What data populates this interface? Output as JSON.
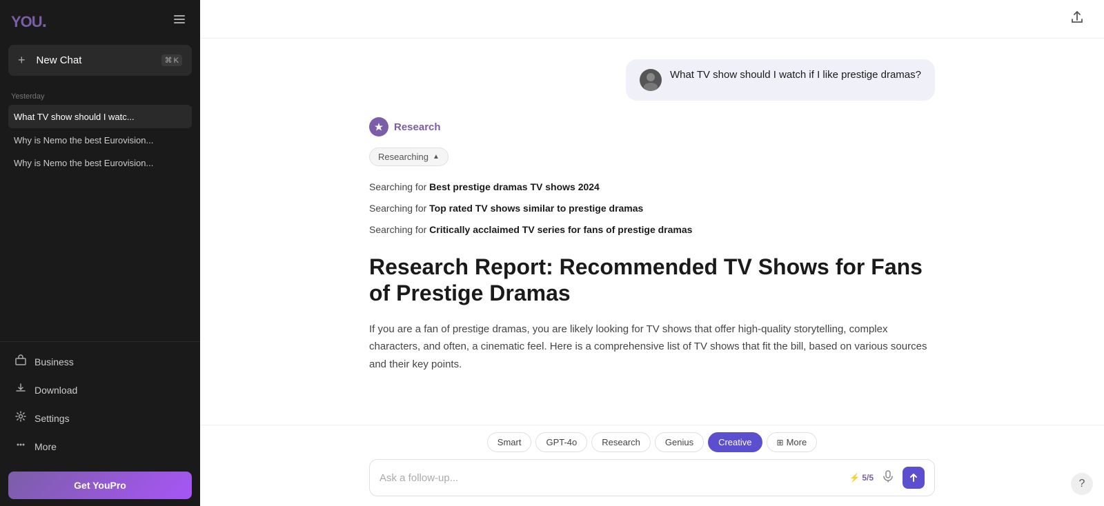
{
  "sidebar": {
    "logo_text": "YOU",
    "logo_dot": ".",
    "new_chat_label": "New Chat",
    "new_chat_shortcut_cmd": "⌘",
    "new_chat_shortcut_key": "K",
    "history_section_label": "Yesterday",
    "history_items": [
      {
        "id": "h1",
        "text": "What TV show should I watc...",
        "active": true
      },
      {
        "id": "h2",
        "text": "Why is Nemo the best Eurovision...",
        "active": false
      },
      {
        "id": "h3",
        "text": "Why is Nemo the best Eurovision...",
        "active": false
      }
    ],
    "footer_items": [
      {
        "id": "business",
        "icon": "🏢",
        "label": "Business"
      },
      {
        "id": "download",
        "icon": "⬇",
        "label": "Download"
      },
      {
        "id": "settings",
        "icon": "⚙",
        "label": "Settings"
      },
      {
        "id": "more",
        "icon": "···",
        "label": "More"
      }
    ],
    "get_pro_label": "Get YouPro"
  },
  "header": {
    "share_icon": "↑"
  },
  "chat": {
    "user_query": "What TV show should I watch if I like prestige dramas?",
    "ai_label": "Research",
    "researching_label": "Researching",
    "search_queries": [
      {
        "prefix": "Searching for ",
        "bold": "Best prestige dramas TV shows 2024"
      },
      {
        "prefix": "Searching for ",
        "bold": "Top rated TV shows similar to prestige dramas"
      },
      {
        "prefix": "Searching for ",
        "bold": "Critically acclaimed TV series for fans of prestige dramas"
      }
    ],
    "report_title": "Research Report: Recommended TV Shows for Fans of Prestige Dramas",
    "report_intro": "If you are a fan of prestige dramas, you are likely looking for TV shows that offer high-quality storytelling, complex characters, and often, a cinematic feel. Here is a comprehensive list of TV shows that fit the bill, based on various sources and their key points."
  },
  "input": {
    "placeholder": "Ask a follow-up...",
    "badge_icon": "⚡",
    "badge_text": "5/5",
    "mic_icon": "🎤",
    "send_icon": "↑"
  },
  "modes": [
    {
      "id": "smart",
      "label": "Smart",
      "active": false
    },
    {
      "id": "gpt4o",
      "label": "GPT-4o",
      "active": false
    },
    {
      "id": "research",
      "label": "Research",
      "active": false
    },
    {
      "id": "genius",
      "label": "Genius",
      "active": false
    },
    {
      "id": "creative",
      "label": "Creative",
      "active": true
    },
    {
      "id": "more",
      "label": "More",
      "active": false
    }
  ],
  "help": {
    "icon": "?"
  }
}
